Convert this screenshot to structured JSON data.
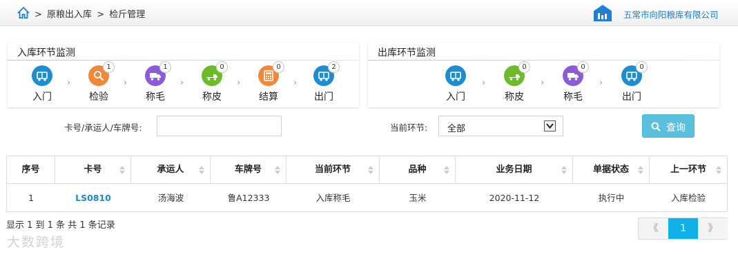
{
  "header": {
    "breadcrumb": [
      ">",
      "原粮出入库",
      ">",
      "检斤管理"
    ],
    "company": "五常市向阳粮库有限公司"
  },
  "inbound": {
    "title": "入库环节监测",
    "steps": [
      {
        "label": "入门",
        "icon": "gate-icon",
        "color": "#1e8ccf",
        "badge": ""
      },
      {
        "label": "检验",
        "icon": "magnifier-icon",
        "color": "#f0883b",
        "badge": "1"
      },
      {
        "label": "称毛",
        "icon": "truck-icon",
        "color": "#8b5cd6",
        "badge": "1"
      },
      {
        "label": "称皮",
        "icon": "truck-empty-icon",
        "color": "#6cbb2a",
        "badge": "0"
      },
      {
        "label": "结算",
        "icon": "calculator-icon",
        "color": "#f0883b",
        "badge": "0"
      },
      {
        "label": "出门",
        "icon": "gate-icon",
        "color": "#1e8ccf",
        "badge": "2"
      }
    ],
    "arrow": "›"
  },
  "outbound": {
    "title": "出库环节监测",
    "steps": [
      {
        "label": "入门",
        "icon": "gate-icon",
        "color": "#1e8ccf",
        "badge": ""
      },
      {
        "label": "称皮",
        "icon": "truck-empty-icon",
        "color": "#6cbb2a",
        "badge": "0"
      },
      {
        "label": "称毛",
        "icon": "truck-icon",
        "color": "#8b5cd6",
        "badge": "0"
      },
      {
        "label": "出门",
        "icon": "gate-icon",
        "color": "#1e8ccf",
        "badge": "0"
      }
    ],
    "arrow": "›"
  },
  "filters": {
    "search_label": "卡号/承运人/车牌号:",
    "search_value": "",
    "stage_label": "当前环节:",
    "stage_value": "全部",
    "query_button": "查询"
  },
  "table": {
    "columns": [
      "序号",
      "卡号",
      "承运人",
      "车牌号",
      "当前环节",
      "品种",
      "业务日期",
      "单据状态",
      "上一环节"
    ],
    "rows": [
      [
        "1",
        "LS0810",
        "汤海波",
        "鲁A12333",
        "入库称毛",
        "玉米",
        "2020-11-12",
        "执行中",
        "入库检验"
      ]
    ]
  },
  "footer": {
    "summary": "显示 1 到 1 条 共 1 条记录",
    "pager": {
      "prev": "《",
      "current": "1",
      "next": "》"
    },
    "watermark": "大数跨境"
  },
  "colors": {
    "accent": "#1a7fd0",
    "query_button": "#5bc0de",
    "page_active": "#0fb1e8"
  }
}
